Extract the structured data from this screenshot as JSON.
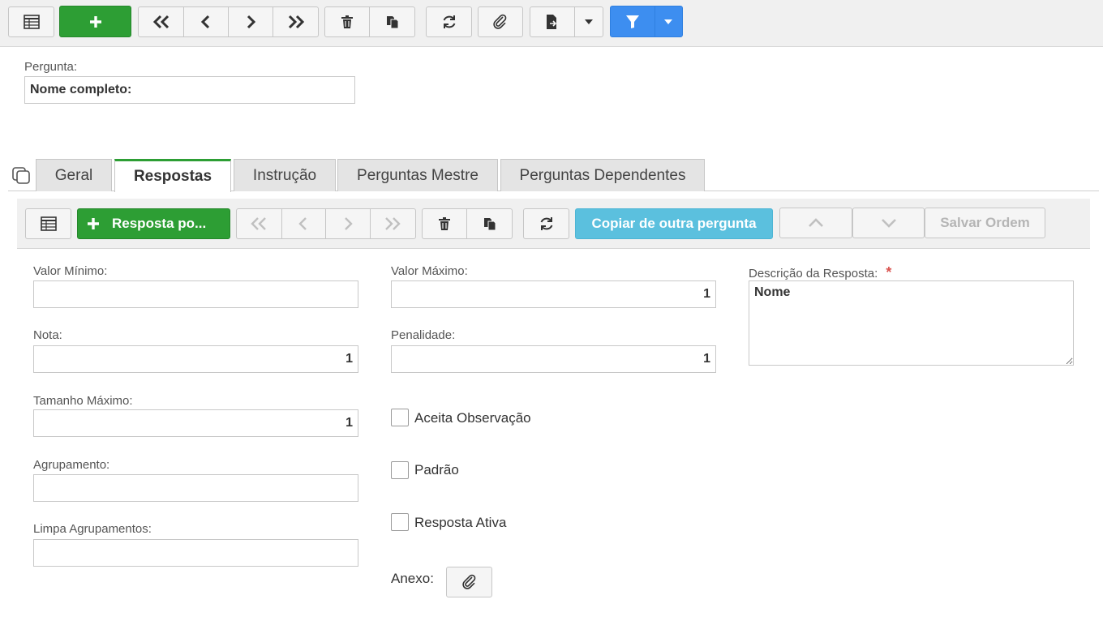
{
  "top_toolbar": {
    "buttons": [
      "table-icon",
      "plus-icon",
      "first-icon",
      "prev-icon",
      "next-icon",
      "last-icon",
      "trash-icon",
      "copy-icon",
      "refresh-icon",
      "paperclip-icon",
      "export-icon",
      "caret-down-icon",
      "filter-icon",
      "caret-down-icon"
    ]
  },
  "pergunta": {
    "label": "Pergunta:",
    "value": "Nome completo:"
  },
  "tabs": [
    {
      "label": "Geral"
    },
    {
      "label": "Respostas"
    },
    {
      "label": "Instrução"
    },
    {
      "label": "Perguntas Mestre"
    },
    {
      "label": "Perguntas Dependentes"
    }
  ],
  "inner_toolbar": {
    "add_label": "Resposta po...",
    "copy_label": "Copiar de outra pergunta",
    "save_order_label": "Salvar Ordem"
  },
  "form": {
    "valor_minimo": {
      "label": "Valor Mínimo:",
      "value": ""
    },
    "valor_maximo": {
      "label": "Valor Máximo:",
      "value": "1"
    },
    "descricao": {
      "label": "Descrição da Resposta:",
      "required_mark": "*",
      "value": "Nome"
    },
    "nota": {
      "label": "Nota:",
      "value": "1"
    },
    "penalidade": {
      "label": "Penalidade:",
      "value": "1"
    },
    "tamanho_maximo": {
      "label": "Tamanho Máximo:",
      "value": "1"
    },
    "agrupamento": {
      "label": "Agrupamento:",
      "value": ""
    },
    "limpa_agrupamentos": {
      "label": "Limpa Agrupamentos:",
      "value": ""
    },
    "aceita_observacao": {
      "label": "Aceita Observação"
    },
    "padrao": {
      "label": "Padrão"
    },
    "resposta_ativa": {
      "label": "Resposta Ativa"
    },
    "anexo": {
      "label": "Anexo:"
    }
  },
  "colors": {
    "green": "#2d9e34",
    "blue": "#3d8ef0",
    "cyan": "#5bc0de"
  }
}
